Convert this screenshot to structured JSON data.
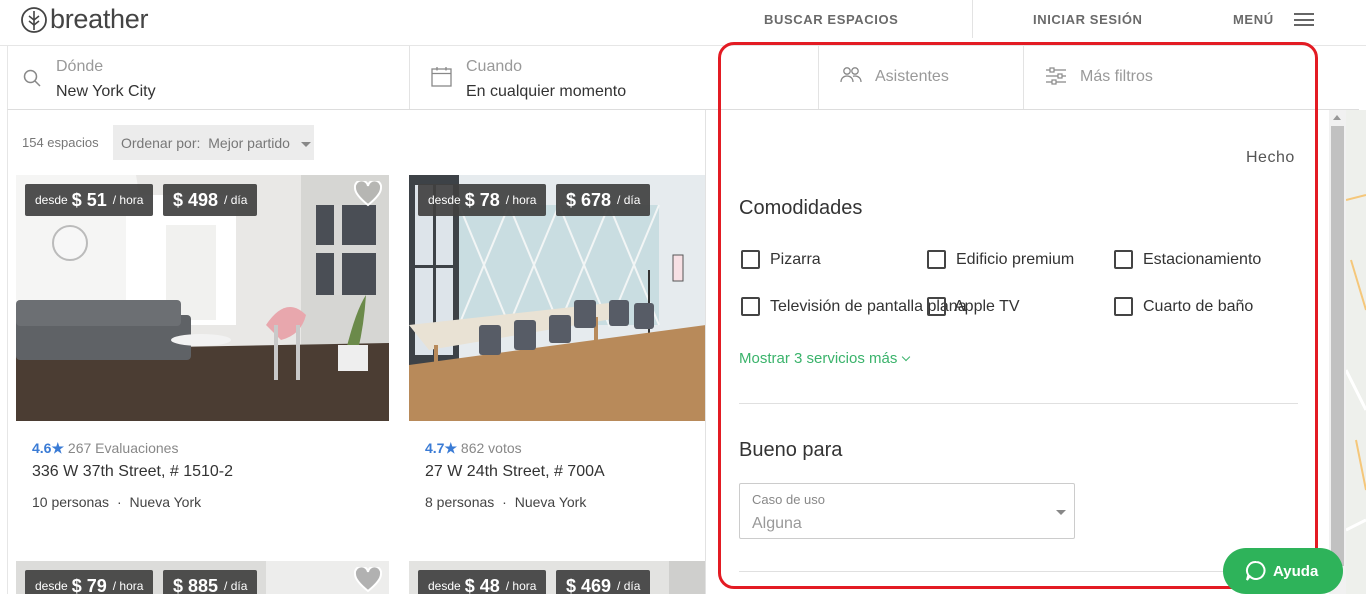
{
  "header": {
    "logo_text": "breather",
    "search_spaces": "BUSCAR ESPACIOS",
    "login": "INICIAR SESIÓN",
    "menu": "MENÚ"
  },
  "searchbar": {
    "where_label": "Dónde",
    "where_value": "New York City",
    "when_label": "Cuando",
    "when_value": "En cualquier momento",
    "attendees": "Asistentes",
    "more_filters": "Más filtros"
  },
  "listing": {
    "count": "154 espacios",
    "sort_label": "Ordenar por:",
    "sort_value": "Mejor partido",
    "cards": [
      {
        "from": "desde",
        "hour_price": "$ 51",
        "hour_unit": "/ hora",
        "day_price": "$ 498",
        "day_unit": "/ día",
        "score": "4.6",
        "star": "★",
        "reviews": "267 Evaluaciones",
        "address": "336 W 37th Street, # 1510-2",
        "capacity": "10 personas",
        "sep": "·",
        "city": "Nueva York"
      },
      {
        "from": "desde",
        "hour_price": "$ 78",
        "hour_unit": "/ hora",
        "day_price": "$ 678",
        "day_unit": "/ día",
        "score": "4.7",
        "star": "★",
        "reviews": "862 votos",
        "address": "27 W 24th Street, # 700A",
        "capacity": "8 personas",
        "sep": "·",
        "city": "Nueva York"
      },
      {
        "from": "desde",
        "hour_price": "$ 79",
        "hour_unit": "/ hora",
        "day_price": "$ 885",
        "day_unit": "/ día"
      },
      {
        "from": "desde",
        "hour_price": "$ 48",
        "hour_unit": "/ hora",
        "day_price": "$ 469",
        "day_unit": "/ día"
      }
    ]
  },
  "filters": {
    "done": "Hecho",
    "amenities_title": "Comodidades",
    "amenities": [
      "Pizarra",
      "Edificio premium",
      "Estacionamiento",
      "Televisión de pantalla plana",
      "Apple TV",
      "Cuarto de baño"
    ],
    "show_more": "Mostrar 3 servicios más",
    "good_for_title": "Bueno para",
    "use_case_label": "Caso de uso",
    "use_case_value": "Alguna"
  },
  "help": {
    "label": "Ayuda"
  },
  "colors": {
    "accent_green": "#3ab36b",
    "highlight_red": "#e31b23",
    "rating_blue": "#3a7bd5"
  }
}
